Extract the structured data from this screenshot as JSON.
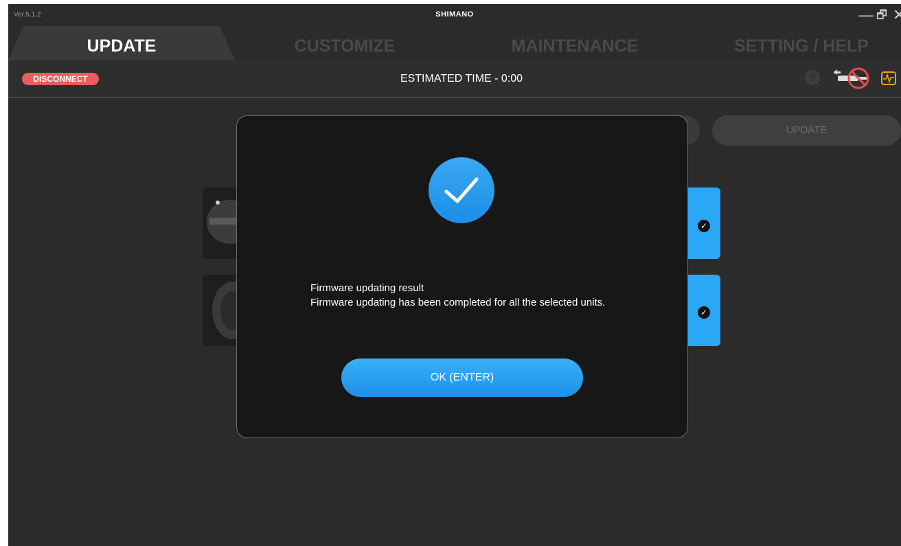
{
  "window": {
    "version": "Ver.5.1.2",
    "brand": "SHIMANO",
    "minimize_glyph": "—",
    "maximize_glyph": "🗗",
    "close_glyph": "✕"
  },
  "tabs": [
    {
      "label": "UPDATE",
      "active": true
    },
    {
      "label": "CUSTOMIZE",
      "active": false
    },
    {
      "label": "MAINTENANCE",
      "active": false
    },
    {
      "label": "SETTING / HELP",
      "active": false
    }
  ],
  "toolbar": {
    "disconnect_label": "DISCONNECT",
    "estimated_time": "ESTIMATED TIME - 0:00",
    "help_glyph": "?",
    "icons": [
      "help-icon",
      "no-connection-icon",
      "pulse-monitor-icon"
    ]
  },
  "background": {
    "update_button_label": "UPDATE",
    "units": [
      {
        "status": "completed",
        "check_glyph": "✓"
      },
      {
        "status": "completed",
        "check_glyph": "✓"
      }
    ]
  },
  "dialog": {
    "icon": "checkmark-icon",
    "title": "Firmware updating result",
    "message": "Firmware updating has been completed for all the selected units.",
    "ok_label": "OK (ENTER)"
  },
  "colors": {
    "accent_blue": "#1d90ea",
    "disconnect_red": "#e85d5d",
    "monitor_orange": "#f0a020",
    "app_bg": "#2b2b2b",
    "dialog_bg": "#171717"
  }
}
